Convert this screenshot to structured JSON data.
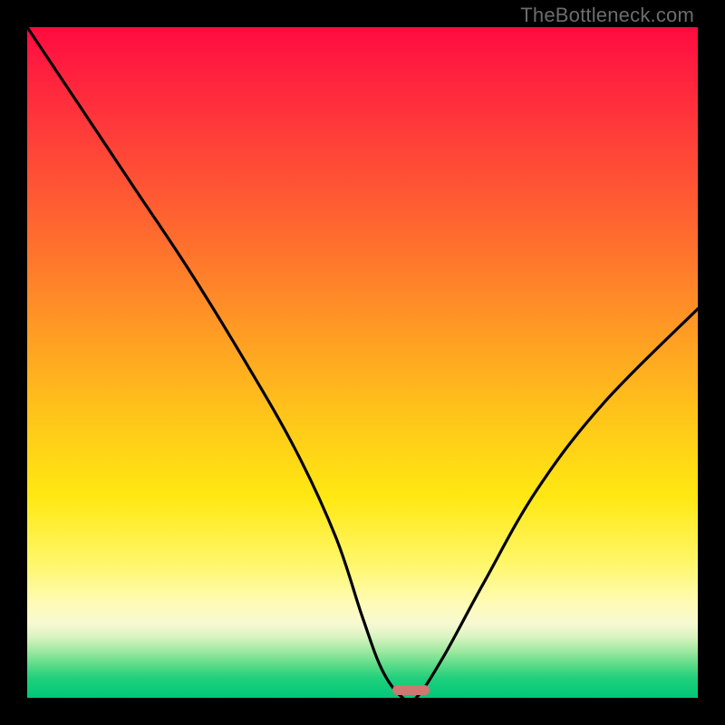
{
  "watermark": "TheBottleneck.com",
  "chart_data": {
    "type": "line",
    "title": "",
    "xlabel": "",
    "ylabel": "",
    "xlim": [
      0,
      100
    ],
    "ylim": [
      0,
      100
    ],
    "grid": false,
    "legend": false,
    "background_gradient": {
      "direction": "vertical",
      "stops": [
        {
          "pos": 0,
          "color": "#ff0a3e"
        },
        {
          "pos": 15,
          "color": "#ff3a3a"
        },
        {
          "pos": 45,
          "color": "#ff9a24"
        },
        {
          "pos": 70,
          "color": "#ffe812"
        },
        {
          "pos": 86,
          "color": "#fffbb8"
        },
        {
          "pos": 93,
          "color": "#9fe9a0"
        },
        {
          "pos": 100,
          "color": "#00c777"
        }
      ]
    },
    "series": [
      {
        "name": "bottleneck-curve",
        "x": [
          0,
          8,
          16,
          24,
          32,
          40,
          46,
          50,
          53,
          56,
          58,
          62,
          68,
          76,
          86,
          100
        ],
        "y": [
          100,
          88,
          76,
          64,
          51,
          37,
          24,
          12,
          4,
          0,
          0,
          6,
          17,
          31,
          44,
          58
        ]
      }
    ],
    "marker": {
      "name": "optimal-range",
      "x_start": 54.5,
      "x_end": 60.0,
      "y": 0,
      "color": "#cd7870"
    }
  }
}
